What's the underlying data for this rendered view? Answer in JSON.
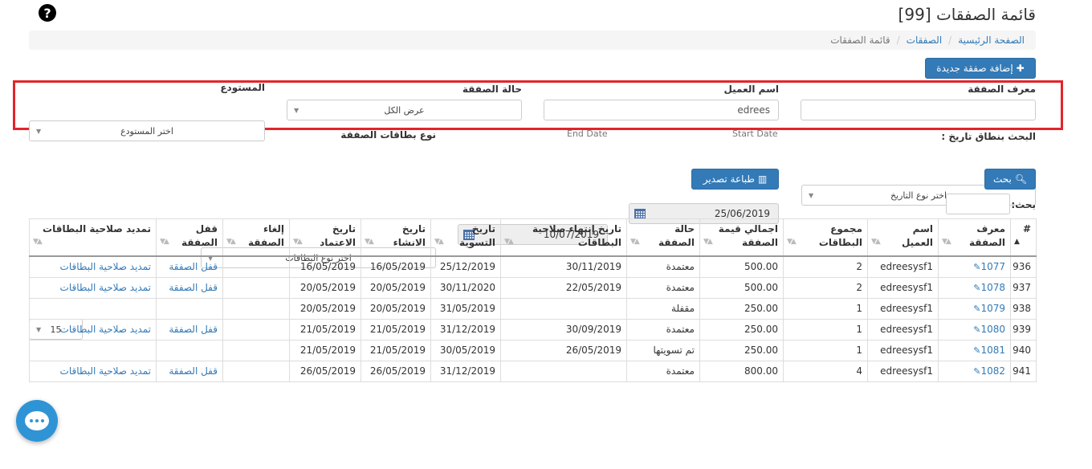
{
  "header": {
    "title": "قائمة الصفقات [99]",
    "help_icon": "question-circle-icon",
    "help_glyph": "?"
  },
  "breadcrumb": [
    "الصفحة الرئيسية",
    "الصفقات",
    "قائمة الصفقات"
  ],
  "actions": {
    "add_deal_label": "إضافة صفقة جديدة",
    "add_icon_glyph": "✚"
  },
  "filters": {
    "deal_id": {
      "label": "معرف الصفقة",
      "value": ""
    },
    "client_name": {
      "label": "اسم العميل",
      "value": "edrees"
    },
    "deal_status": {
      "label": "حالة الصفقة",
      "selected": "عرض الكل"
    },
    "warehouse": {
      "label": "المستودع",
      "selected": "اختر المستودع"
    },
    "date_range": {
      "label": "البحث بنطاق تاريخ :",
      "selected": "اختر نوع التاريخ"
    },
    "start_date": {
      "label": "Start Date",
      "value": "25/06/2019"
    },
    "end_date": {
      "label": "End Date",
      "value": "10/07/2019"
    },
    "card_type": {
      "label": "نوع بطاقات الصفقة",
      "selected": "اختر نوع البطاقات"
    },
    "search_button": "بحث",
    "print_export_button": "طباعة تصدير"
  },
  "table_controls": {
    "search_label": "بحث:",
    "page_size": "15"
  },
  "accent_color": "#337ab7",
  "highlight_color": "#e3242b",
  "table": {
    "headers": [
      "#",
      "معرف الصفقة",
      "اسم العميل",
      "مجموع البطاقات",
      "اجمالي قيمة الصفقة",
      "حالة الصفقة",
      "تاريخ إنتهاء صلاحية البطاقات",
      "تاريخ التسوية",
      "تاريخ الانشاء",
      "تاريخ الاعتماد",
      "إلغاء الصفقة",
      "قفل الصفقة",
      "تمديد صلاحية البطاقات"
    ],
    "rows": [
      [
        "936",
        "1077",
        "edreesysf1",
        "2",
        "500.00",
        "معتمدة",
        "30/11/2019",
        "25/12/2019",
        "16/05/2019",
        "16/05/2019",
        "",
        "قفل الصفقة",
        "تمديد صلاحية البطاقات"
      ],
      [
        "937",
        "1078",
        "edreesysf1",
        "2",
        "500.00",
        "معتمدة",
        "22/05/2019",
        "30/11/2020",
        "20/05/2019",
        "20/05/2019",
        "",
        "قفل الصفقة",
        "تمديد صلاحية البطاقات"
      ],
      [
        "938",
        "1079",
        "edreesysf1",
        "1",
        "250.00",
        "مقفلة",
        "",
        "31/05/2019",
        "20/05/2019",
        "20/05/2019",
        "",
        "",
        ""
      ],
      [
        "939",
        "1080",
        "edreesysf1",
        "1",
        "250.00",
        "معتمدة",
        "30/09/2019",
        "31/12/2019",
        "21/05/2019",
        "21/05/2019",
        "",
        "قفل الصفقة",
        "تمديد صلاحية البطاقات"
      ],
      [
        "940",
        "1081",
        "edreesysf1",
        "1",
        "250.00",
        "تم تسويتها",
        "26/05/2019",
        "30/05/2019",
        "21/05/2019",
        "21/05/2019",
        "",
        "",
        ""
      ],
      [
        "941",
        "1082",
        "edreesysf1",
        "4",
        "800.00",
        "معتمدة",
        "",
        "31/12/2019",
        "26/05/2019",
        "26/05/2019",
        "",
        "قفل الصفقة",
        "تمديد صلاحية البطاقات"
      ]
    ]
  }
}
